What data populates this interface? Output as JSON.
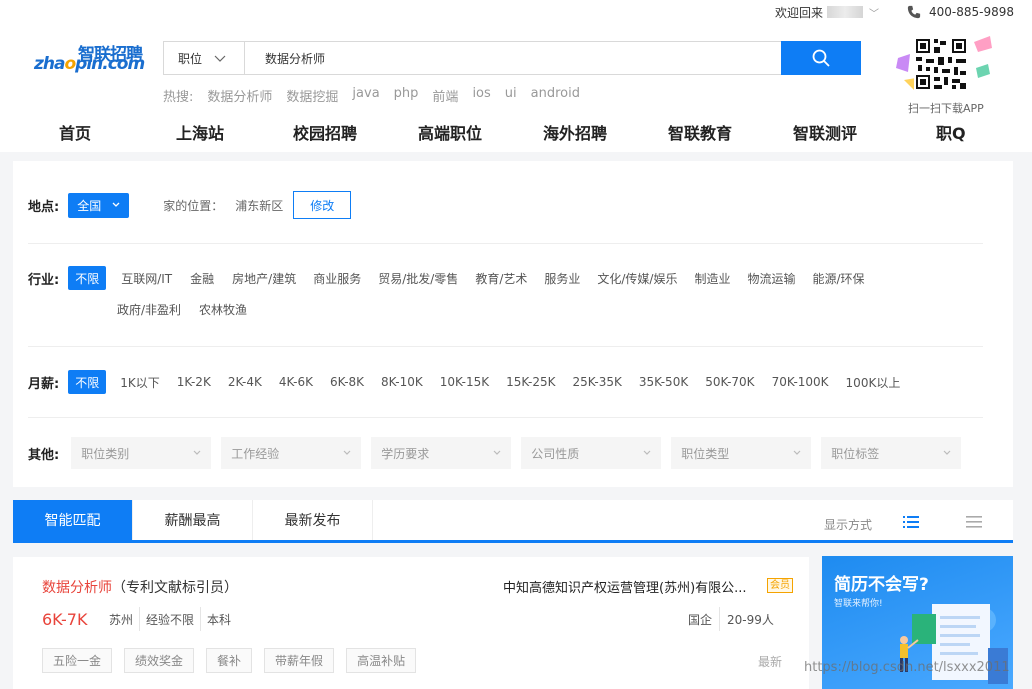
{
  "topbar": {
    "welcome": "欢迎回来",
    "phone": "400-885-9898"
  },
  "logo": {
    "cn": "智联招聘",
    "en_pre": "zha",
    "en_o": "o",
    "en_post": "pin.com"
  },
  "search": {
    "category": "职位",
    "query": "数据分析师"
  },
  "hot": {
    "label": "热搜:",
    "items": [
      "数据分析师",
      "数据挖掘",
      "java",
      "php",
      "前端",
      "ios",
      "ui",
      "android"
    ]
  },
  "qr": {
    "caption": "扫一扫下载APP"
  },
  "nav": [
    "首页",
    "上海站",
    "校园招聘",
    "高端职位",
    "海外招聘",
    "智联教育",
    "智联测评",
    "职Q"
  ],
  "filters": {
    "location": {
      "label": "地点:",
      "value": "全国",
      "home_label": "家的位置：",
      "home_value": "浦东新区",
      "edit": "修改"
    },
    "industry": {
      "label": "行业:",
      "selected": "不限",
      "row1": [
        "互联网/IT",
        "金融",
        "房地产/建筑",
        "商业服务",
        "贸易/批发/零售",
        "教育/艺术",
        "服务业",
        "文化/传媒/娱乐",
        "制造业",
        "物流运输",
        "能源/环保"
      ],
      "row2": [
        "政府/非盈利",
        "农林牧渔"
      ]
    },
    "salary": {
      "label": "月薪:",
      "selected": "不限",
      "options": [
        "1K以下",
        "1K-2K",
        "2K-4K",
        "4K-6K",
        "6K-8K",
        "8K-10K",
        "10K-15K",
        "15K-25K",
        "25K-35K",
        "35K-50K",
        "50K-70K",
        "70K-100K",
        "100K以上"
      ]
    },
    "other": {
      "label": "其他:",
      "dropdowns": [
        "职位类别",
        "工作经验",
        "学历要求",
        "公司性质",
        "职位类型",
        "职位标签"
      ]
    }
  },
  "tabs": [
    "智能匹配",
    "薪酬最高",
    "最新发布"
  ],
  "view": {
    "label": "显示方式"
  },
  "job": {
    "title": "数据分析师",
    "subtitle": "（专利文献标引员）",
    "salary": "6K-7K",
    "attrs": [
      "苏州",
      "经验不限",
      "本科"
    ],
    "company": "中知高德知识产权运营管理(苏州)有限公...",
    "member": "会员",
    "company_attrs": [
      "国企",
      "20-99人"
    ],
    "tags": [
      "五险一金",
      "绩效奖金",
      "餐补",
      "带薪年假",
      "高温补贴"
    ],
    "posted": "最新"
  },
  "ad": {
    "title": "简历不会写?",
    "subtitle": "智联来帮你!"
  },
  "watermark": "https://blog.csdn.net/lsxxx2011",
  "colors": {
    "primary": "#0e7df5",
    "salary_red": "#e8443b",
    "member_orange": "#f5a300"
  }
}
